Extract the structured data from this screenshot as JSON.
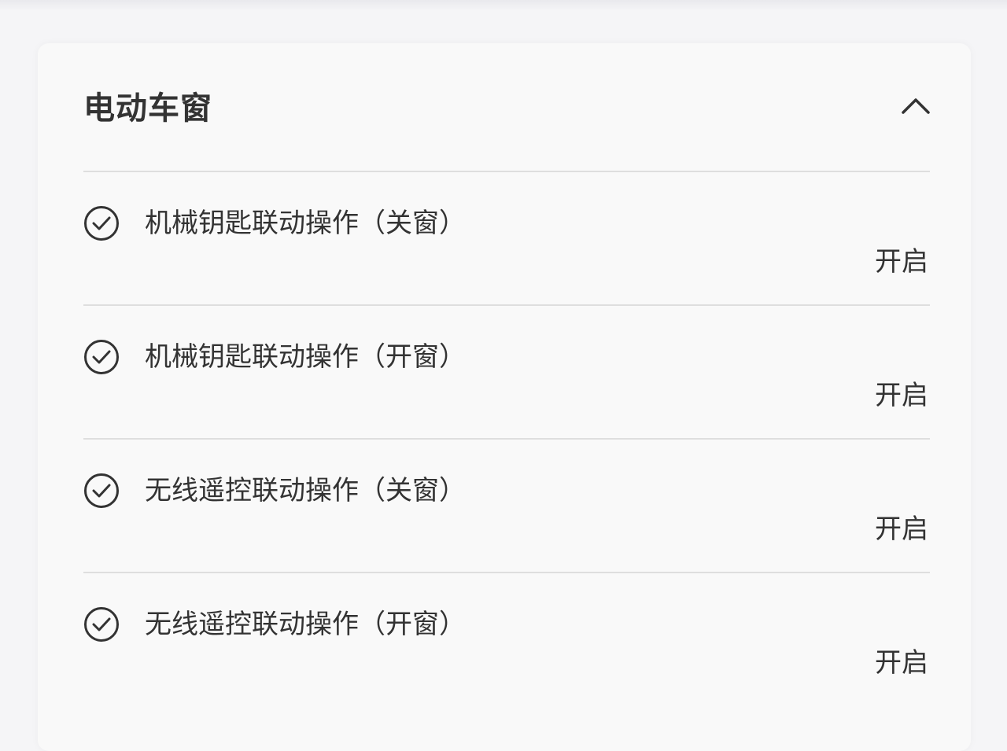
{
  "section": {
    "title": "电动车窗",
    "icon": "chevron-up-icon"
  },
  "items": [
    {
      "label": "机械钥匙联动操作（关窗）",
      "value": "开启",
      "icon": "check-circle-icon"
    },
    {
      "label": "机械钥匙联动操作（开窗）",
      "value": "开启",
      "icon": "check-circle-icon"
    },
    {
      "label": "无线遥控联动操作（关窗）",
      "value": "开启",
      "icon": "check-circle-icon"
    },
    {
      "label": "无线遥控联动操作（开窗）",
      "value": "开启",
      "icon": "check-circle-icon"
    }
  ],
  "colors": {
    "background": "#f5f5f7",
    "card": "#f9f9f9",
    "text": "#333333",
    "divider": "#dedede"
  }
}
